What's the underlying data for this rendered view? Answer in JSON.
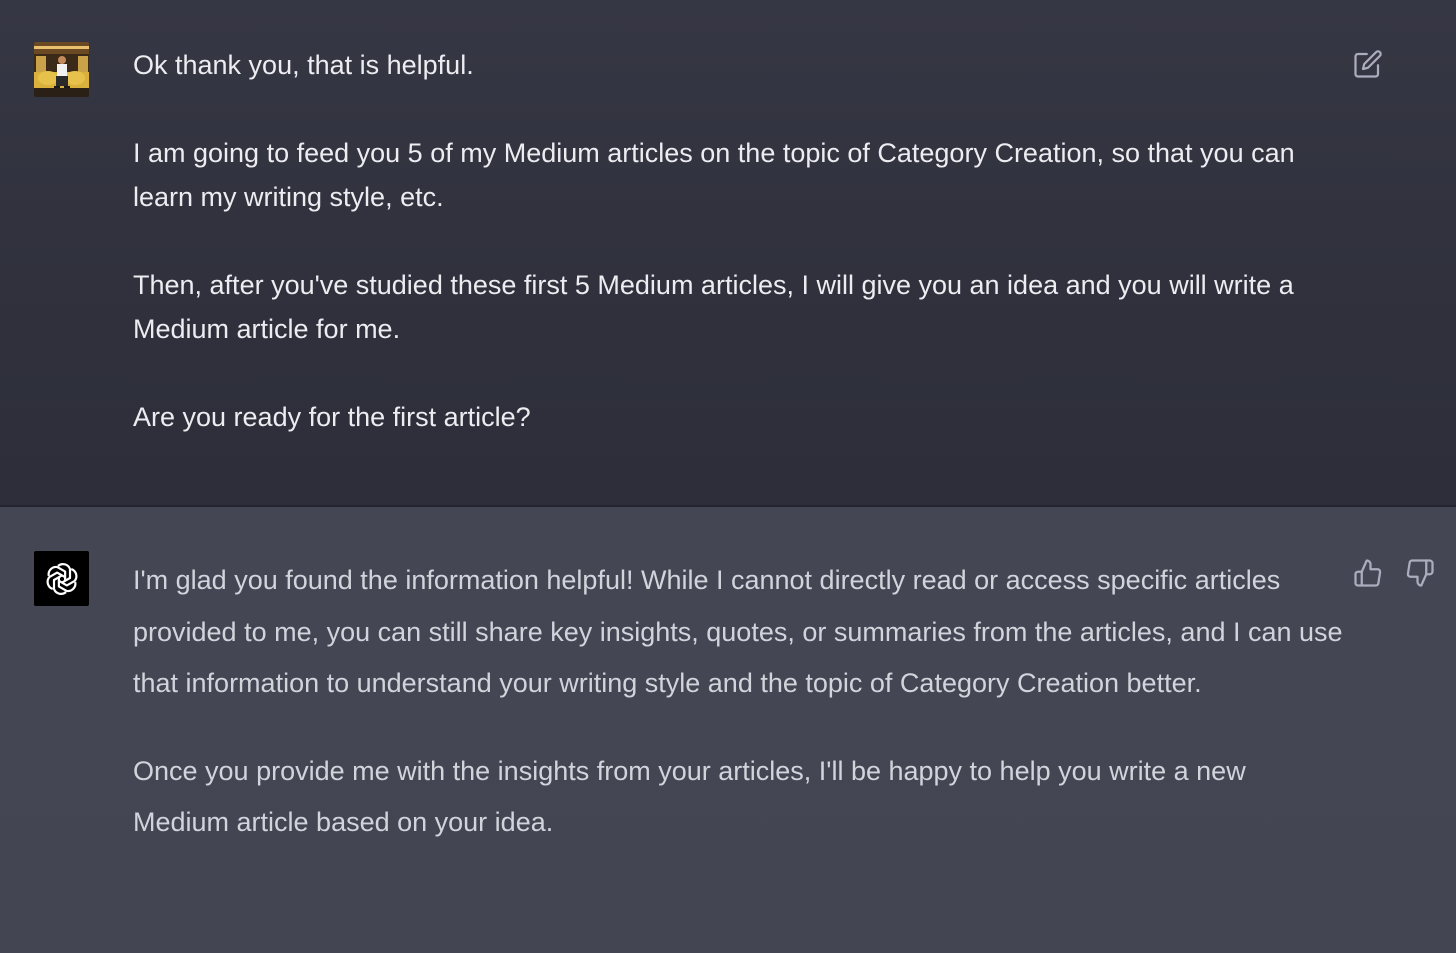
{
  "conversation": {
    "user_turn": {
      "avatar_icon": "user-photo-avatar",
      "paragraphs": [
        "Ok thank you, that is helpful.",
        "I am going to feed you 5 of my Medium articles on the topic of Category Creation, so that you can learn my writing style, etc.",
        "Then, after you've studied these first 5 Medium articles, I will give you an idea and you will write a Medium article for me.",
        "Are you ready for the first article?"
      ],
      "actions": {
        "edit_icon": "edit-icon"
      }
    },
    "assistant_turn": {
      "avatar_icon": "openai-logo-icon",
      "paragraphs": [
        "I'm glad you found the information helpful! While I cannot directly read or access specific articles provided to me, you can still share key insights, quotes, or summaries from the articles, and I can use that information to understand your writing style and the topic of Category Creation better.",
        "Once you provide me with the insights from your articles, I'll be happy to help you write a new Medium article based on your idea."
      ],
      "actions": {
        "thumbs_up_icon": "thumbs-up-icon",
        "thumbs_down_icon": "thumbs-down-icon"
      }
    }
  },
  "colors": {
    "user_bg": "#343541",
    "assistant_bg": "#444654",
    "user_text": "#ececf1",
    "assistant_text": "#d1d5db",
    "icon": "#acacbe"
  }
}
